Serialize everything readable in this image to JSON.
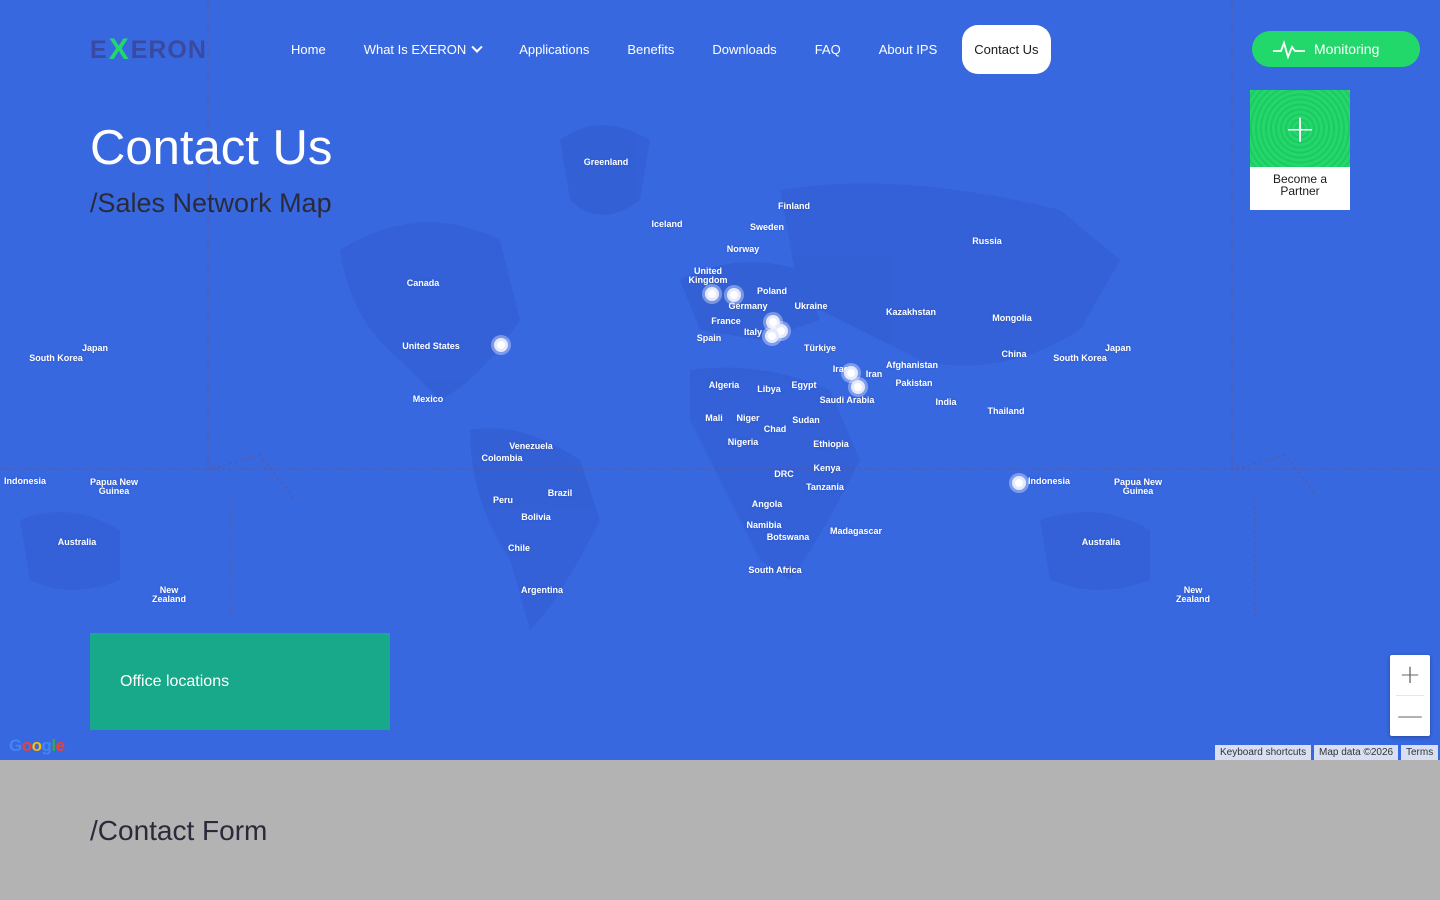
{
  "header": {
    "logo": {
      "prefix": "E",
      "x": "X",
      "suffix": "ERON"
    },
    "nav": [
      {
        "label": "Home"
      },
      {
        "label": "What Is EXERON",
        "has_dropdown": true
      },
      {
        "label": "Applications"
      },
      {
        "label": "Benefits"
      },
      {
        "label": "Downloads"
      },
      {
        "label": "FAQ"
      },
      {
        "label": "About IPS"
      },
      {
        "label": "Contact Us",
        "active": true
      }
    ],
    "monitoring_label": "Monitoring",
    "monitoring_icon": "heartbeat-icon"
  },
  "partner": {
    "label_line1": "Become a",
    "label_line2": "Partner",
    "icon": "plus-icon"
  },
  "hero": {
    "title": "Contact Us",
    "subtitle": "/Sales Network Map"
  },
  "map": {
    "office_locations_label": "Office locations",
    "zoom_in": "+",
    "zoom_out": "—",
    "google": "Google",
    "keyboard_shortcuts": "Keyboard shortcuts",
    "map_data": "Map data ©2026",
    "terms": "Terms",
    "country_labels": [
      "Greenland",
      "Iceland",
      "Finland",
      "Sweden",
      "Norway",
      "Russia",
      "United Kingdom",
      "Poland",
      "Germany",
      "Ukraine",
      "France",
      "Italy",
      "Spain",
      "Kazakhstan",
      "Mongolia",
      "Türkiye",
      "China",
      "South Korea",
      "Japan",
      "Afghanistan",
      "Iraq",
      "Iran",
      "Pakistan",
      "Algeria",
      "Libya",
      "Egypt",
      "Saudi Arabia",
      "India",
      "Thailand",
      "Mali",
      "Niger",
      "Chad",
      "Sudan",
      "Nigeria",
      "Ethiopia",
      "Kenya",
      "DRC",
      "Tanzania",
      "Angola",
      "Namibia",
      "Botswana",
      "Madagascar",
      "South Africa",
      "Indonesia",
      "Papua New Guinea",
      "Australia",
      "New Zealand",
      "Canada",
      "United States",
      "Mexico",
      "Venezuela",
      "Colombia",
      "Peru",
      "Brazil",
      "Bolivia",
      "Chile",
      "Argentina"
    ],
    "colors": {
      "water": "#3868e0",
      "land": "#3562d8",
      "accent": "#22d86a",
      "office": "#18a88a"
    }
  },
  "form": {
    "title": "/Contact Form"
  }
}
